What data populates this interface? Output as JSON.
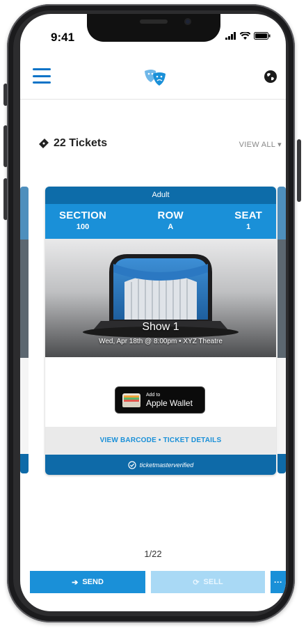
{
  "status_bar": {
    "time": "9:41"
  },
  "header": {
    "menu_icon": "hamburger-menu-icon",
    "logo_icon": "theatre-masks-icon",
    "globe_icon": "globe-icon"
  },
  "tickets": {
    "count_label": "22 Tickets",
    "view_all": "VIEW ALL",
    "ticket_icon": "ticket-icon"
  },
  "card": {
    "type_label": "Adult",
    "section": {
      "label": "SECTION",
      "value": "100"
    },
    "row": {
      "label": "ROW",
      "value": "A"
    },
    "seat": {
      "label": "SEAT",
      "value": "1"
    },
    "show_name": "Show 1",
    "show_details": "Wed, Apr 18th @ 8:00pm • XYZ Theatre",
    "wallet": {
      "small": "Add to",
      "big": "Apple Wallet"
    },
    "links": "VIEW BARCODE • TICKET DETAILS",
    "footer": "ticketmasterverified"
  },
  "pager": "1/22",
  "actions": {
    "send": "SEND",
    "sell": "SELL",
    "more": "···"
  },
  "colors": {
    "primary": "#1a90d8",
    "dark_blue": "#0d6ca9",
    "disabled": "#a9d9f5"
  }
}
